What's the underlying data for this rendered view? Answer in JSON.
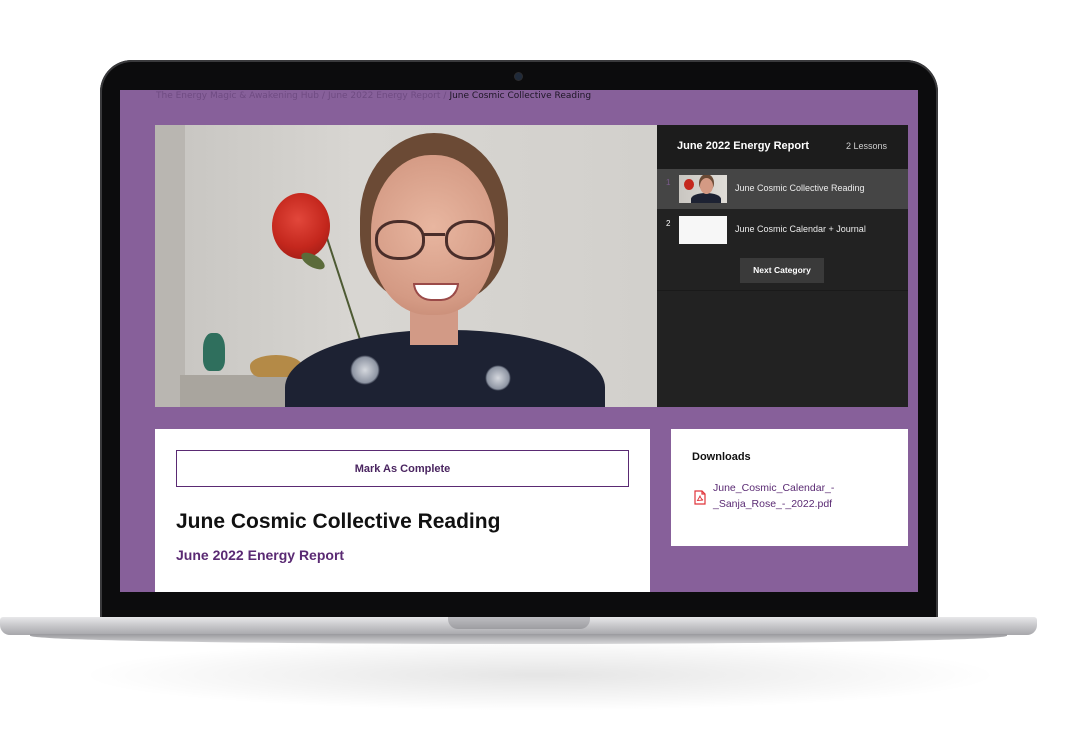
{
  "breadcrumb": {
    "items": [
      "The Energy Magic & Awakening Hub",
      "June 2022 Energy Report"
    ],
    "current": "June Cosmic Collective Reading"
  },
  "lessons_panel": {
    "title": "June 2022 Energy Report",
    "count": "2 Lessons",
    "items": [
      {
        "number": "1",
        "label": "June Cosmic Collective Reading",
        "active": true
      },
      {
        "number": "2",
        "label": "June Cosmic Calendar + Journal",
        "active": false
      }
    ],
    "next_button": "Next Category"
  },
  "lesson": {
    "mark_complete": "Mark As Complete",
    "title": "June Cosmic Collective Reading",
    "category": "June 2022 Energy Report"
  },
  "downloads": {
    "title": "Downloads",
    "file": "June_Cosmic_Calendar_-_Sanja_Rose_-_2022.pdf",
    "file_icon": "pdf-file-icon"
  },
  "colors": {
    "page_background": "#87609a",
    "accent": "#5a2a73",
    "panel_dark": "#222222"
  }
}
